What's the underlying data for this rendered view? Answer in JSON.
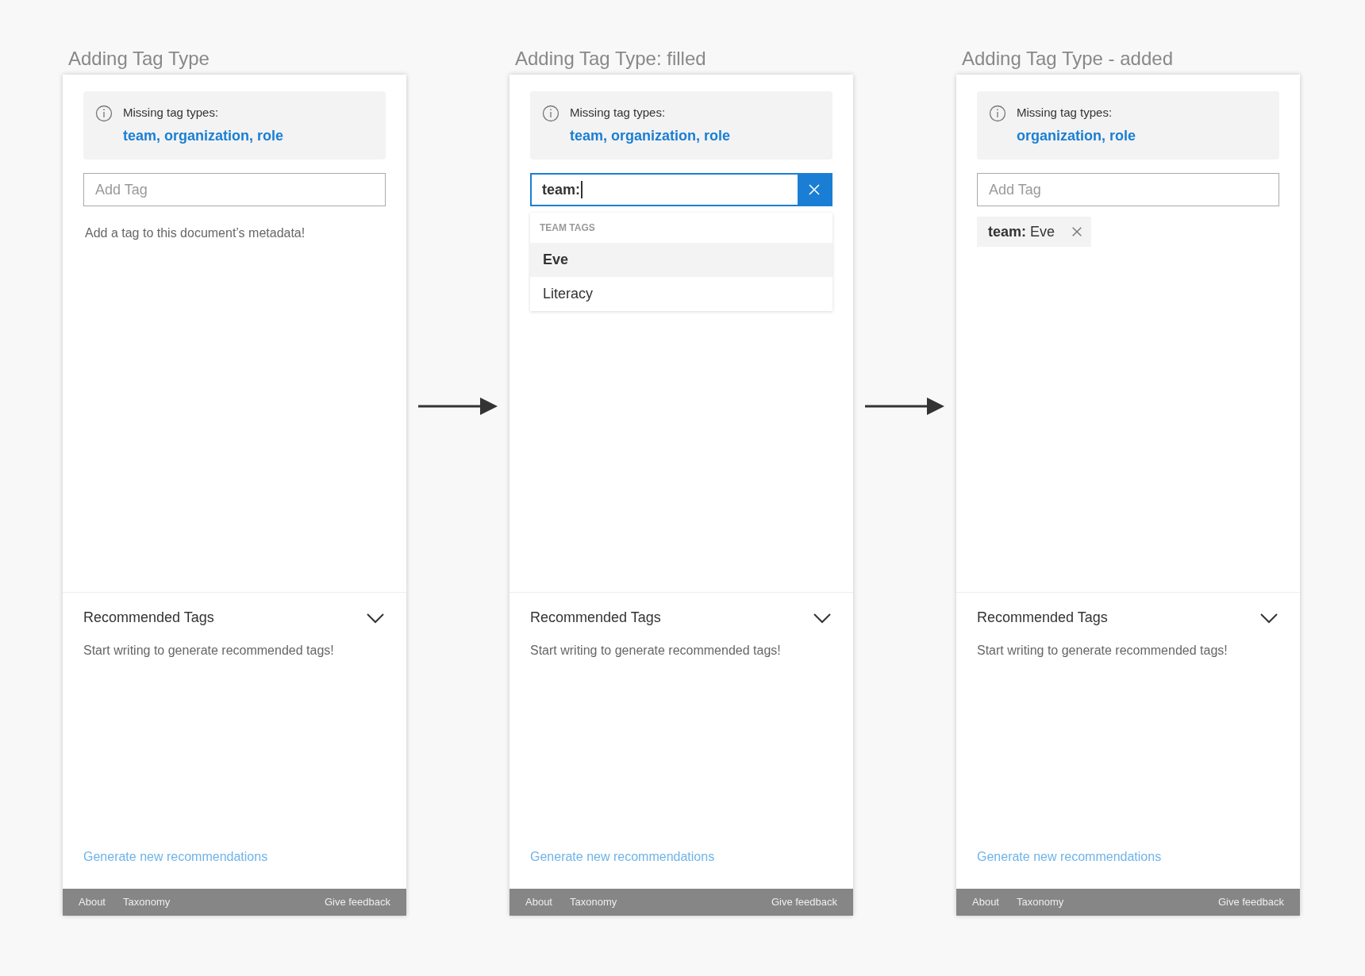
{
  "panels": [
    {
      "title": "Adding Tag Type",
      "notice": {
        "label": "Missing tag types:",
        "types": "team, organization, role"
      },
      "input": {
        "kind": "empty",
        "placeholder": "Add Tag"
      },
      "helper": "Add a tag to this document’s metadata!",
      "recommended": {
        "title": "Recommended Tags",
        "expanded": true,
        "message": "Start writing to generate recommended tags!",
        "link": "Generate new recommendations"
      },
      "footer": {
        "links": [
          "About",
          "Taxonomy"
        ],
        "feedback": "Give feedback"
      }
    },
    {
      "title": "Adding Tag Type: filled",
      "notice": {
        "label": "Missing tag types:",
        "types": "team, organization, role"
      },
      "input": {
        "kind": "filled",
        "value": "team:"
      },
      "dropdown": {
        "header": "TEAM TAGS",
        "items": [
          {
            "label": "Eve",
            "selected": true
          },
          {
            "label": "Literacy",
            "selected": false
          }
        ]
      },
      "recommended": {
        "title": "Recommended Tags",
        "expanded": true,
        "message": "Start writing to generate recommended tags!",
        "link": "Generate new recommendations"
      },
      "footer": {
        "links": [
          "About",
          "Taxonomy"
        ],
        "feedback": "Give feedback"
      }
    },
    {
      "title": "Adding Tag Type - added",
      "notice": {
        "label": "Missing tag types:",
        "types": "organization, role"
      },
      "input": {
        "kind": "empty",
        "placeholder": "Add Tag"
      },
      "tags": [
        "**team:** Eve"
      ],
      "recommended": {
        "title": "Recommended Tags",
        "expanded": true,
        "message": "Start writing to generate recommended tags!",
        "link": "Generate new recommendations"
      },
      "footer": {
        "links": [
          "About",
          "Taxonomy"
        ],
        "feedback": "Give feedback"
      }
    }
  ]
}
